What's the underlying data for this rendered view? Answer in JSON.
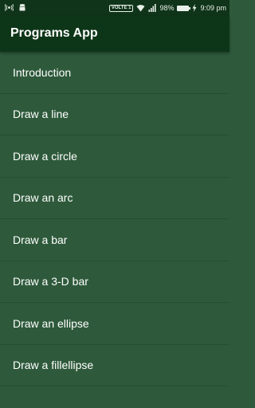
{
  "status_bar": {
    "volte_label": "VOLTE 1",
    "battery_text": "98%",
    "battery_level": 0.98,
    "time": "9:09 pm"
  },
  "app_bar": {
    "title": "Programs App"
  },
  "list": {
    "items": [
      {
        "label": "Introduction"
      },
      {
        "label": "Draw a line"
      },
      {
        "label": "Draw a circle"
      },
      {
        "label": "Draw an arc"
      },
      {
        "label": "Draw a bar"
      },
      {
        "label": "Draw a 3-D bar"
      },
      {
        "label": "Draw an ellipse"
      },
      {
        "label": "Draw a fillellipse"
      }
    ]
  },
  "colors": {
    "status_bar_bg": "#0f3419",
    "app_bar_bg": "#0d3618",
    "list_bg": "#2e5a3b",
    "divider": "#245031",
    "text": "#ffffff"
  },
  "icons": [
    "cast-icon",
    "android-icon",
    "volte-icon",
    "wifi-icon",
    "signal-icon",
    "battery-icon",
    "charging-icon"
  ]
}
